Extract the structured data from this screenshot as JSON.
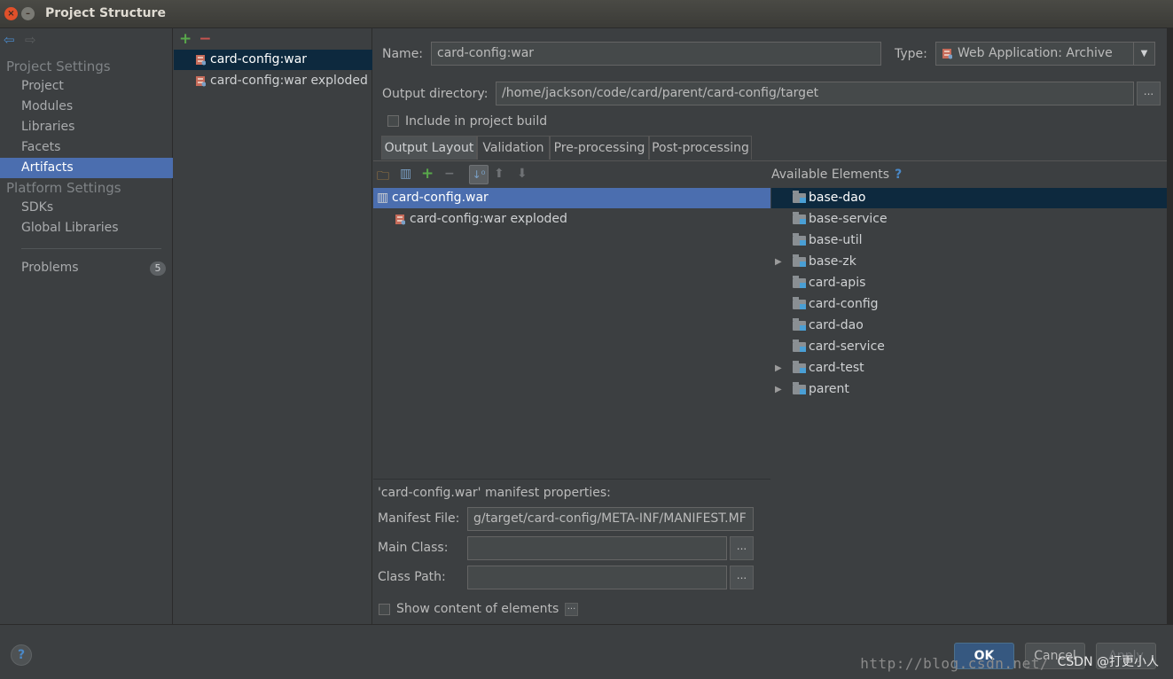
{
  "window": {
    "title": "Project Structure"
  },
  "sidebar": {
    "project_settings_head": "Project Settings",
    "project_items": [
      "Project",
      "Modules",
      "Libraries",
      "Facets",
      "Artifacts"
    ],
    "selected": "Artifacts",
    "platform_settings_head": "Platform Settings",
    "platform_items": [
      "SDKs",
      "Global Libraries"
    ],
    "problems_label": "Problems",
    "problems_count": "5"
  },
  "artifacts": {
    "items": [
      "card-config:war",
      "card-config:war exploded"
    ],
    "selected_index": 0
  },
  "editor": {
    "name_label": "Name:",
    "name_value": "card-config:war",
    "type_label": "Type:",
    "type_value": "Web Application: Archive",
    "output_dir_label": "Output directory:",
    "output_dir_value": "/home/jackson/code/card/parent/card-config/target",
    "include_label": "Include in project build",
    "include_checked": false,
    "browse": "...",
    "tabs": [
      "Output Layout",
      "Validation",
      "Pre-processing",
      "Post-processing"
    ],
    "selected_tab": "Output Layout"
  },
  "layout_tree": {
    "rows": [
      "card-config.war",
      "card-config:war exploded"
    ]
  },
  "available": {
    "header": "Available Elements",
    "help": "?",
    "rows": [
      {
        "label": "base-dao",
        "expandable": false,
        "selected": true
      },
      {
        "label": "base-service",
        "expandable": false
      },
      {
        "label": "base-util",
        "expandable": false
      },
      {
        "label": "base-zk",
        "expandable": true
      },
      {
        "label": "card-apis",
        "expandable": false
      },
      {
        "label": "card-config",
        "expandable": false
      },
      {
        "label": "card-dao",
        "expandable": false
      },
      {
        "label": "card-service",
        "expandable": false
      },
      {
        "label": "card-test",
        "expandable": true
      },
      {
        "label": "parent",
        "expandable": true
      }
    ]
  },
  "manifest": {
    "title": "'card-config.war' manifest properties:",
    "manifest_file_label": "Manifest File:",
    "manifest_file_value": "g/target/card-config/META-INF/MANIFEST.MF",
    "main_class_label": "Main Class:",
    "main_class_value": "",
    "class_path_label": "Class Path:",
    "class_path_value": "",
    "show_content_label": "Show content of elements"
  },
  "footer": {
    "help": "?",
    "ok": "OK",
    "cancel": "Cancel",
    "apply": "Apply",
    "watermark": "http://blog.csdn.net/",
    "csdn": "CSDN @打更小人"
  }
}
